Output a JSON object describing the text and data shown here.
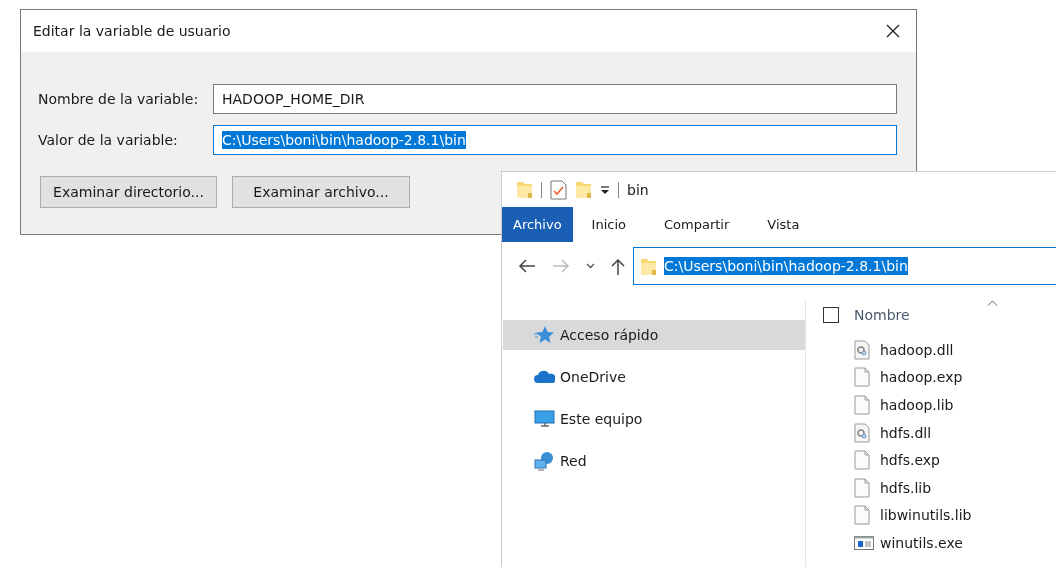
{
  "dialog": {
    "title": "Editar la variable de usuario",
    "fields": [
      {
        "label": "Nombre de la variable:",
        "value": "HADOOP_HOME_DIR",
        "text_selected": false
      },
      {
        "label": "Valor de la variable:",
        "value": "C:\\Users\\boni\\bin\\hadoop-2.8.1\\bin",
        "text_selected": true
      }
    ],
    "buttons": [
      "Examinar directorio...",
      "Examinar archivo..."
    ]
  },
  "explorer": {
    "title": "bin",
    "tabs": [
      {
        "label": "Archivo",
        "selected": true
      },
      {
        "label": "Inicio",
        "selected": false
      },
      {
        "label": "Compartir",
        "selected": false
      },
      {
        "label": "Vista",
        "selected": false
      }
    ],
    "address": {
      "value": "C:\\Users\\boni\\bin\\hadoop-2.8.1\\bin",
      "text_selected": true
    },
    "nav_items": [
      {
        "label": "Acceso rápido",
        "kind": "star",
        "selected": true
      },
      {
        "label": "OneDrive",
        "kind": "cloud",
        "selected": false
      },
      {
        "label": "Este equipo",
        "kind": "computer",
        "selected": false
      },
      {
        "label": "Red",
        "kind": "network",
        "selected": false
      }
    ],
    "select_all_checked": false,
    "column_header": "Nombre",
    "files": [
      {
        "name": "hadoop.dll",
        "kind": "dll"
      },
      {
        "name": "hadoop.exp",
        "kind": "file"
      },
      {
        "name": "hadoop.lib",
        "kind": "file"
      },
      {
        "name": "hdfs.dll",
        "kind": "dll"
      },
      {
        "name": "hdfs.exp",
        "kind": "file"
      },
      {
        "name": "hdfs.lib",
        "kind": "file"
      },
      {
        "name": "libwinutils.lib",
        "kind": "file"
      },
      {
        "name": "winutils.exe",
        "kind": "exe"
      }
    ]
  }
}
